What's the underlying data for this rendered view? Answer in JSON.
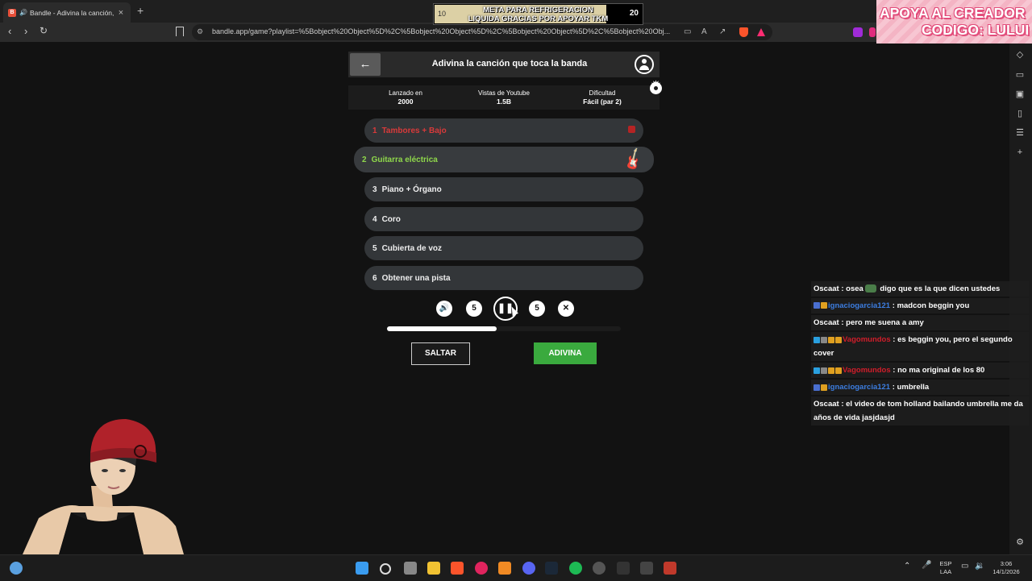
{
  "browser": {
    "tab_title": "Bandle - Adivina la canción, u",
    "tab_close": "×",
    "new_tab": "+",
    "url": "bandle.app/game?playlist=%5Bobject%20Object%5D%2C%5Bobject%20Object%5D%2C%5Bobject%20Object%5D%2C%5Bobject%20Obj..."
  },
  "goal": {
    "start": "10",
    "text": "META PARA REFRIGERACION\nLIQUIDA GRACIAS POR APOYAR TKM",
    "end": "20",
    "progress": 0.83
  },
  "creator": {
    "line1": "APOYA AL CREADOR",
    "line2": "CODIGO: LULUI"
  },
  "game": {
    "title": "Adivina la canción que toca la banda",
    "info": [
      {
        "label": "Lanzado en",
        "value": "2000"
      },
      {
        "label": "Vistas de Youtube",
        "value": "1.5B"
      },
      {
        "label": "Dificultad",
        "value": "Fácil (par 2)"
      }
    ],
    "instruments": [
      {
        "num": "1",
        "label": "Tambores + Bajo",
        "state": "wrong"
      },
      {
        "num": "2",
        "label": "Guitarra eléctrica",
        "state": "active"
      },
      {
        "num": "3",
        "label": "Piano + Órgano",
        "state": "locked"
      },
      {
        "num": "4",
        "label": "Coro",
        "state": "locked"
      },
      {
        "num": "5",
        "label": "Cubierta de voz",
        "state": "locked"
      },
      {
        "num": "6",
        "label": "Obtener una pista",
        "state": "locked"
      }
    ],
    "controls": {
      "volume": "🔊",
      "rewind": "5",
      "pause": "❚❚",
      "forward": "5",
      "shuffle": "✕"
    },
    "progress": 0.47,
    "skip_label": "SALTAR",
    "guess_label": "ADIVINA"
  },
  "chat": [
    {
      "user": "Oscaat",
      "color": "#ffffff",
      "text": "osea",
      "emote": true,
      "after": "digo que es la que dicen ustedes",
      "badges": []
    },
    {
      "user": "ignaciogarcia121",
      "color": "#3c7de0",
      "text": "madcon beggin you",
      "badges": [
        "#4a6fd0",
        "#e0a020"
      ]
    },
    {
      "user": "Oscaat",
      "color": "#ffffff",
      "text": "pero me suena a amy",
      "badges": []
    },
    {
      "user": "Vagomundos",
      "color": "#d11d2a",
      "text": "es beggin you, pero el segundo cover",
      "badges": [
        "#2aa0e0",
        "#888888",
        "#e0a020",
        "#e0a020"
      ]
    },
    {
      "user": "Vagomundos",
      "color": "#d11d2a",
      "text": "no ma original de los 80",
      "badges": [
        "#2aa0e0",
        "#888888",
        "#e0a020",
        "#e0a020"
      ]
    },
    {
      "user": "ignaciogarcia121",
      "color": "#3c7de0",
      "text": "umbrella",
      "badges": [
        "#4a6fd0",
        "#e0a020"
      ]
    },
    {
      "user": "Oscaat",
      "color": "#ffffff",
      "text": "el video de tom holland bailando umbrella me da años de vida jasjdasjd",
      "badges": []
    }
  ],
  "taskbar": {
    "lang_top": "ESP",
    "lang_bottom": "LAA",
    "time": "3:06",
    "date": "14/1/2026"
  }
}
